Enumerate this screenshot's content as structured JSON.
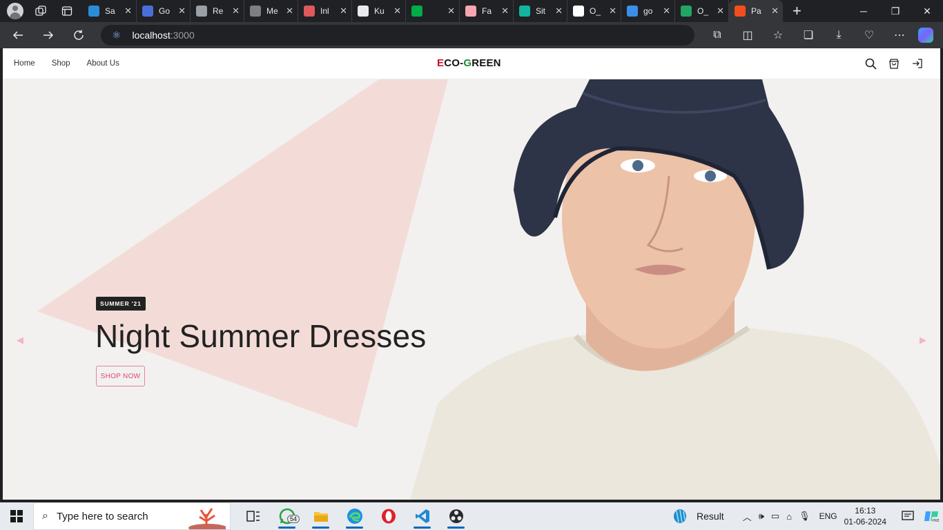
{
  "browser": {
    "tabs": [
      {
        "title": "Sa",
        "favicon": "telegram-icon",
        "color": "#2b8dd6"
      },
      {
        "title": "Go",
        "favicon": "docs-icon",
        "color": "#4a6fd8"
      },
      {
        "title": "Re",
        "favicon": "chatgpt-icon",
        "color": "#9aa0a6"
      },
      {
        "title": "Me",
        "favicon": "mail-icon",
        "color": "#7e7e86"
      },
      {
        "title": "Inl",
        "favicon": "inline-icon",
        "color": "#e0585c"
      },
      {
        "title": "Ku",
        "favicon": "github-icon",
        "color": "#e8eaed"
      },
      {
        "title": "",
        "favicon": "meet-icon",
        "color": "#00ac47"
      },
      {
        "title": "Fa",
        "favicon": "figma-f-icon",
        "color": "#f6a6b0"
      },
      {
        "title": "Sit",
        "favicon": "site-icon",
        "color": "#12b5a0"
      },
      {
        "title": "O_",
        "favicon": "page-icon",
        "color": "#ffffff"
      },
      {
        "title": "go",
        "favicon": "search-icon",
        "color": "#3c8ee8"
      },
      {
        "title": "O_",
        "favicon": "sheets-icon",
        "color": "#21a464"
      },
      {
        "title": "Pa",
        "favicon": "figma-icon",
        "color": "#f24e1e"
      }
    ],
    "url_host": "localhost",
    "url_port": ":3000"
  },
  "site": {
    "nav": {
      "home": "Home",
      "shop": "Shop",
      "about": "About Us"
    },
    "logo": {
      "first": "E",
      "middle": "CO-",
      "g": "G",
      "rest": "REEN"
    }
  },
  "hero": {
    "badge": "SUMMER '21",
    "headline": "Night Summer Dresses",
    "cta": "SHOP NOW",
    "bg_color": "#f2f1ef",
    "triangle_color": "#f3dcd8"
  },
  "taskbar": {
    "search_placeholder": "Type here to search",
    "whatsapp_count": "54",
    "weather_label": "Result",
    "language": "ENG",
    "time": "16:13",
    "date": "01-06-2024"
  }
}
